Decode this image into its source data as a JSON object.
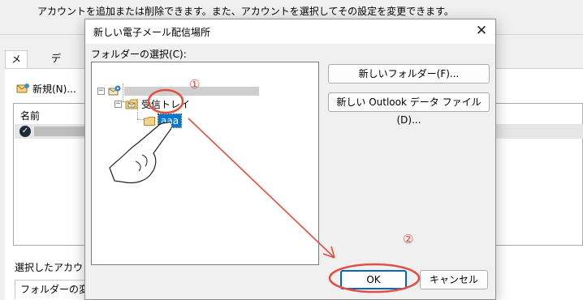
{
  "background_window": {
    "description": "アカウントを追加または削除できます。また、アカウントを選択してその設定を変更できます。",
    "tabs": [
      "メール",
      "データフ"
    ],
    "new_button_label": "新規(N)...",
    "column_name": "名前",
    "selected_account_label": "選択したアカウント",
    "change_folder_button_label": "フォルダーの変更"
  },
  "dialog": {
    "title": "新しい電子メール配信場所",
    "close_glyph": "✕",
    "folder_select_label": "フォルダーの選択(C):",
    "tree": {
      "root_expander": "−",
      "inbox_expander": "−",
      "inbox_label": "受信トレイ",
      "selected_folder_label": "aaa"
    },
    "buttons": {
      "new_folder": "新しいフォルダー(F)...",
      "new_outlook_data_file": "新しい Outlook データ ファイル(D)...",
      "ok": "OK",
      "cancel": "キャンセル"
    }
  },
  "annotations": {
    "step1": "①",
    "step2": "②",
    "accent_color": "#e05040"
  },
  "icons": {
    "close": "close-icon",
    "new_account": "mail-account-icon",
    "default_account": "check-circle-icon",
    "root_mailbox": "mailbox-icon",
    "inbox": "inbox-folder-icon",
    "folder": "folder-icon",
    "pointer": "pointing-hand-icon"
  }
}
